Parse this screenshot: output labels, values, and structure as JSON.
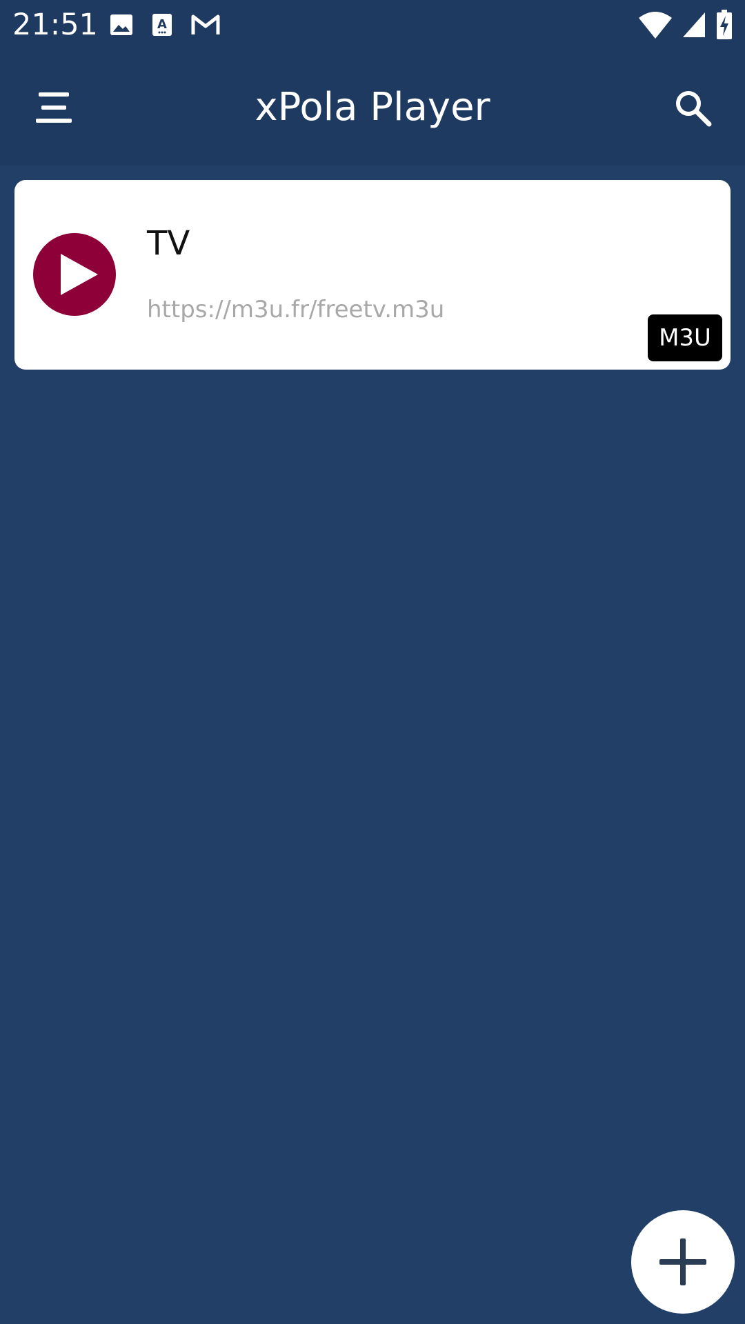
{
  "status_bar": {
    "time": "21:51",
    "left_icons": [
      "image-icon",
      "a-notification-icon",
      "gmail-icon"
    ],
    "right_icons": [
      "wifi-icon",
      "signal-icon",
      "battery-charging-icon"
    ]
  },
  "app_bar": {
    "title": "xPola Player",
    "menu_icon": "hamburger-menu-icon",
    "search_icon": "search-icon"
  },
  "playlists": [
    {
      "name": "TV",
      "url": "https://m3u.fr/freetv.m3u",
      "type": "M3U",
      "icon": "play-circle-icon"
    }
  ],
  "fab": {
    "icon": "plus-icon"
  },
  "colors": {
    "background": "#213F67",
    "app_bar": "#1F3A60",
    "play_icon": "#8E0038",
    "card": "#ffffff",
    "badge": "#000000",
    "url_text": "#A8A8A8",
    "fab_icon": "#2B3D55"
  }
}
